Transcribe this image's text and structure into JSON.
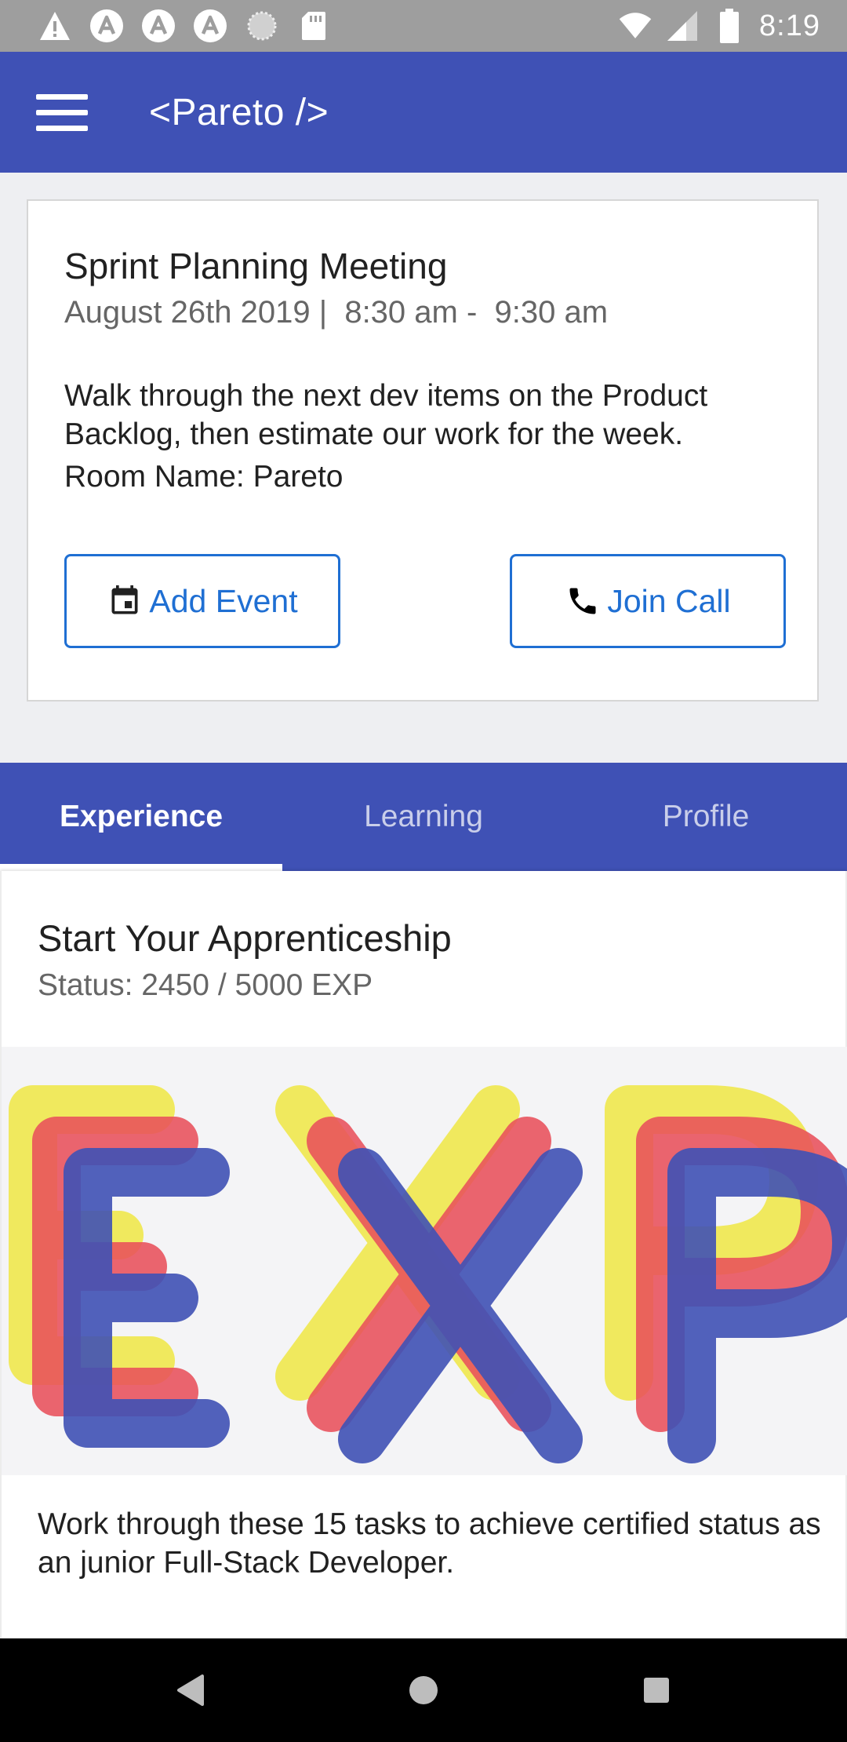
{
  "status_bar": {
    "time": "8:19",
    "left_icons": [
      "warning-icon",
      "angular-app-icon",
      "angular-app-icon",
      "angular-app-icon",
      "loading-icon",
      "sd-card-icon"
    ],
    "right_icons": [
      "wifi-icon",
      "signal-icon",
      "battery-icon"
    ]
  },
  "app_bar": {
    "title": "<Pareto />",
    "menu_icon": "hamburger-menu-icon",
    "color": "#3f51b5"
  },
  "event": {
    "title": "Sprint Planning Meeting",
    "date_time": "August 26th 2019 |  8:30 am -  9:30 am",
    "description": "Walk through the next dev items on the Product Backlog, then estimate our work for the week.",
    "room": "Room Name: Pareto",
    "add_event_label": "Add Event",
    "add_event_icon": "calendar-icon",
    "join_call_label": "Join Call",
    "join_call_icon": "phone-icon",
    "accent_color": "#1f6fd3"
  },
  "tabs": [
    {
      "label": "Experience",
      "active": true
    },
    {
      "label": "Learning",
      "active": false
    },
    {
      "label": "Profile",
      "active": false
    }
  ],
  "experience": {
    "title": "Start Your Apprenticeship",
    "status": "Status: 2450 / 5000 EXP",
    "progress_fraction": 0.49,
    "image_text": "EXP",
    "image_colors": [
      "#f0e84e",
      "#e8505b",
      "#3f51b5"
    ],
    "description": "Work through these 15 tasks to achieve certified status as an junior Full-Stack Developer."
  },
  "nav_bar": {
    "icons": [
      "back-icon",
      "home-icon",
      "recents-icon"
    ]
  }
}
